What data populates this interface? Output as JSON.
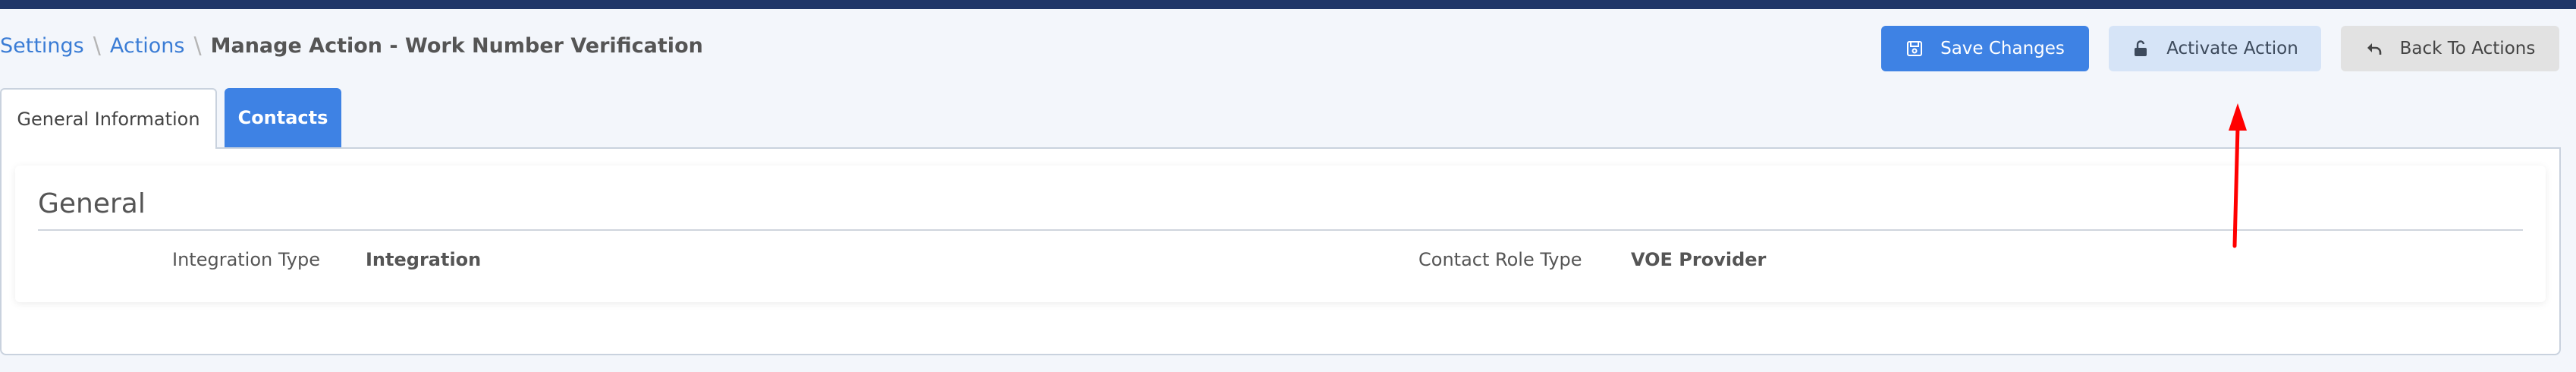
{
  "breadcrumb": {
    "items": [
      "Settings",
      "Actions"
    ],
    "separator": "\\",
    "current": "Manage Action - Work Number Verification"
  },
  "toolbar": {
    "save_label": "Save Changes",
    "activate_label": "Activate Action",
    "back_label": "Back To Actions",
    "save_icon": "save-icon",
    "activate_icon": "unlock-icon",
    "back_icon": "reply-arrow-icon"
  },
  "tabs": [
    {
      "label": "General Information",
      "active": true
    },
    {
      "label": "Contacts",
      "active": false
    }
  ],
  "section": {
    "title": "General",
    "fields": [
      {
        "label": "Integration Type",
        "value": "Integration"
      },
      {
        "label": "Contact Role Type",
        "value": "VOE Provider"
      }
    ]
  },
  "colors": {
    "topbar": "#1f3668",
    "primary": "#3e82e4",
    "activate_bg": "#d6e4f7",
    "back_bg": "#e2e2e2",
    "link": "#3a7cd5",
    "annotation": "#ff0000"
  }
}
